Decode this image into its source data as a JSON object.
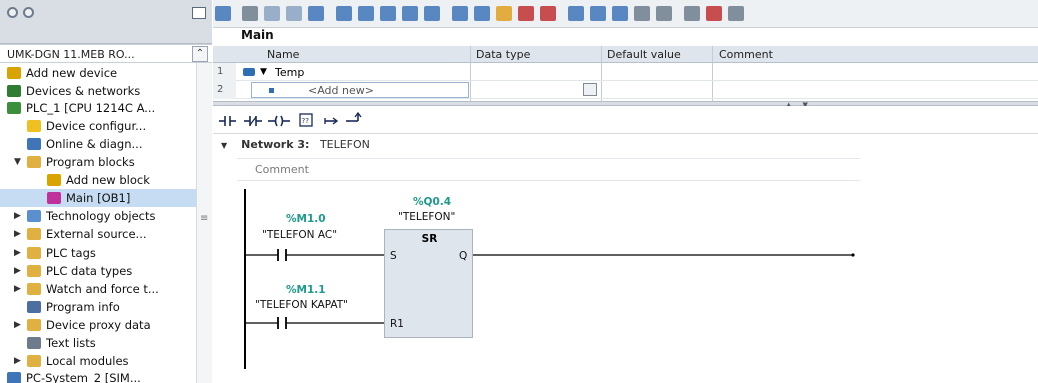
{
  "tree": {
    "header": "UMK-DGN 11.MEB RO...",
    "items": [
      {
        "label": "Add new device",
        "icon": "add-device-icon",
        "color": "#d9a400"
      },
      {
        "label": "Devices & networks",
        "icon": "network-icon",
        "color": "#2e7d32"
      },
      {
        "label": "PLC_1 [CPU 1214C A...",
        "icon": "plc-icon",
        "color": "#3b8f3b"
      },
      {
        "label": "Device configur...",
        "icon": "device-config-icon",
        "color": "#f0c020"
      },
      {
        "label": "Online & diagn...",
        "icon": "online-diag-icon",
        "color": "#3e74b8"
      },
      {
        "label": "Program blocks",
        "icon": "folder-icon",
        "color": "#e0b040"
      },
      {
        "label": "Add new block",
        "icon": "add-block-icon",
        "color": "#d9a400"
      },
      {
        "label": "Main [OB1]",
        "icon": "ob-block-icon",
        "color": "#c0309a"
      },
      {
        "label": "Technology objects",
        "icon": "technology-icon",
        "color": "#5a8fd0"
      },
      {
        "label": "External source...",
        "icon": "external-source-icon",
        "color": "#e0b040"
      },
      {
        "label": "PLC tags",
        "icon": "tags-icon",
        "color": "#e0b040"
      },
      {
        "label": "PLC data types",
        "icon": "data-types-icon",
        "color": "#e0b040"
      },
      {
        "label": "Watch and force t...",
        "icon": "watch-icon",
        "color": "#e0b040"
      },
      {
        "label": "Program info",
        "icon": "program-info-icon",
        "color": "#4a6fa0"
      },
      {
        "label": "Device proxy data",
        "icon": "proxy-icon",
        "color": "#e0b040"
      },
      {
        "label": "Text lists",
        "icon": "text-list-icon",
        "color": "#6d7c8c"
      },
      {
        "label": "Local modules",
        "icon": "local-modules-icon",
        "color": "#e0b040"
      },
      {
        "label": "PC-System_2 [SIM...",
        "icon": "pc-system-icon",
        "color": "#3e74b8"
      }
    ]
  },
  "editor": {
    "block_title": "Main",
    "interface": {
      "columns": [
        "Name",
        "Data type",
        "Default value",
        "Comment"
      ],
      "rows": [
        {
          "num": "1",
          "name": "Temp"
        },
        {
          "num": "2",
          "name": "<Add new>"
        }
      ]
    },
    "network": {
      "title_prefix": "Network 3:",
      "title_name": "TELEFON",
      "comment": "Comment"
    },
    "ladder": {
      "contact1": {
        "address": "%M1.0",
        "symbol": "\"TELEFON AC\""
      },
      "contact2": {
        "address": "%M1.1",
        "symbol": "\"TELEFON KAPAT\""
      },
      "coil": {
        "address": "%Q0.4",
        "symbol": "\"TELEFON\""
      },
      "block": {
        "type": "SR",
        "pin_s": "S",
        "pin_r": "R1",
        "pin_q": "Q"
      }
    }
  }
}
